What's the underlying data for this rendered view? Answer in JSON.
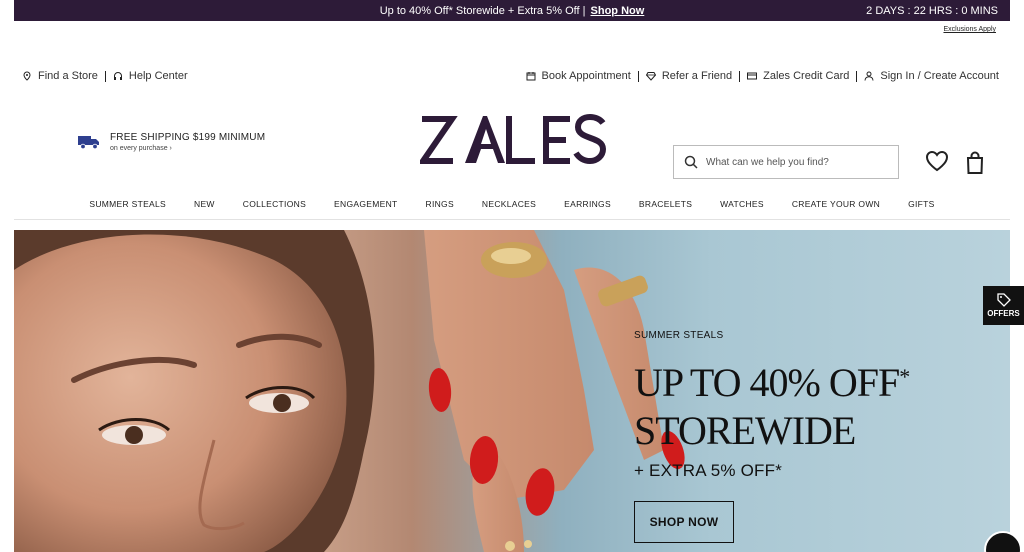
{
  "promo": {
    "message": "Up to 40% Off* Storewide + Extra 5% Off |",
    "shop_link": "Shop Now",
    "countdown": "2 DAYS : 22 HRS : 0 MINS",
    "exclusions": "Exclusions Apply"
  },
  "utility_left": [
    {
      "label": "Find a Store",
      "icon": "map-pin-icon"
    },
    {
      "label": "Help Center",
      "icon": "help-center-icon"
    }
  ],
  "utility_right": [
    {
      "label": "Book Appointment",
      "icon": "calendar-icon"
    },
    {
      "label": "Refer a Friend",
      "icon": "diamond-icon"
    },
    {
      "label": "Zales Credit Card",
      "icon": "credit-card-icon"
    },
    {
      "label": "Sign In / Create Account",
      "icon": "user-icon"
    }
  ],
  "shipping": {
    "title": "FREE SHIPPING $199 MINIMUM",
    "subtitle": "on every purchase ›",
    "icon": "truck-icon"
  },
  "logo": {
    "text": "ZALES",
    "color": "#2d1b38"
  },
  "search": {
    "placeholder": "What can we help you find?"
  },
  "nav": [
    "SUMMER STEALS",
    "NEW",
    "COLLECTIONS",
    "ENGAGEMENT",
    "RINGS",
    "NECKLACES",
    "EARRINGS",
    "BRACELETS",
    "WATCHES",
    "CREATE YOUR OWN",
    "GIFTS"
  ],
  "hero": {
    "eyebrow": "SUMMER STEALS",
    "headline_line1": "UP TO 40% OFF",
    "headline_asterisk": "*",
    "headline_line2": "STOREWIDE",
    "subline": "+ EXTRA 5% OFF*",
    "cta": "SHOP NOW"
  },
  "offers_tab": {
    "label": "OFFERS",
    "icon": "tag-icon"
  },
  "colors": {
    "brand": "#2d1b38",
    "nail": "#d01c1c",
    "gold": "#c9a15a"
  }
}
